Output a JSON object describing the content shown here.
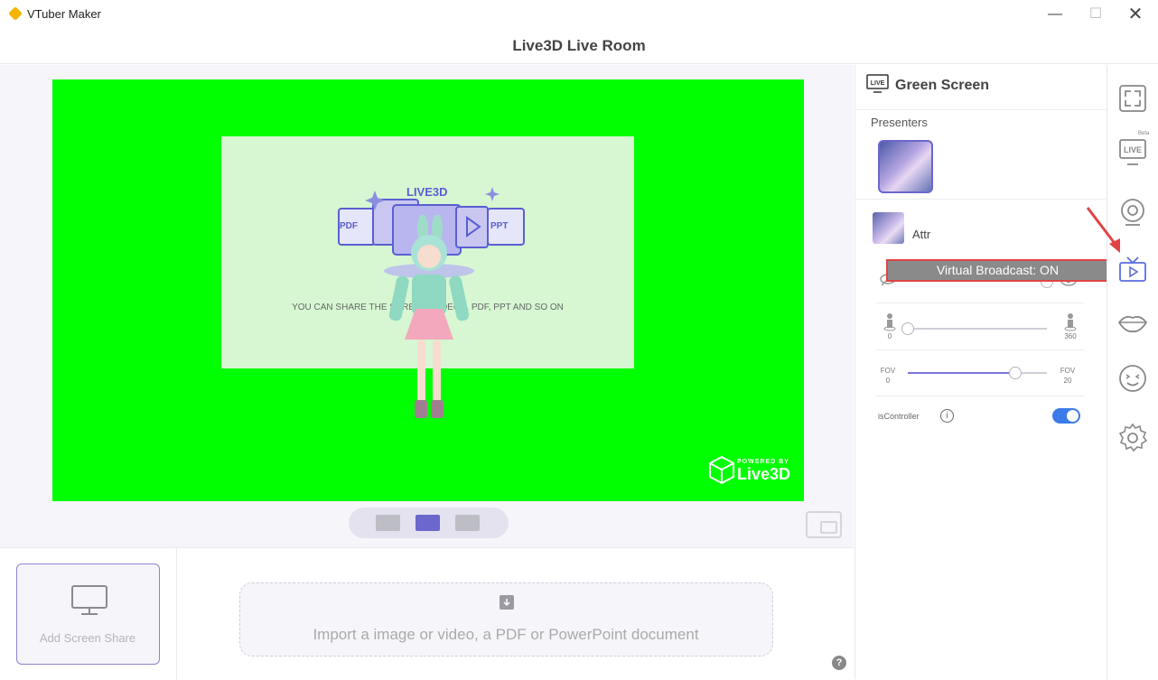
{
  "window": {
    "app_title": "VTuber Maker",
    "min_glyph": "—",
    "max_glyph": "☐",
    "close_glyph": "✕"
  },
  "header": {
    "title": "Live3D Live Room"
  },
  "stage": {
    "background_color": "#00ff00",
    "share_card_text": "YOU CAN SHARE THE SCREEN, VIDEOS, PDF, PPT AND SO ON",
    "logo_text": "LIVE3D",
    "pdf_label": "PDF",
    "ppt_label": "PPT",
    "watermark_small": "POWERED BY",
    "watermark_big": "Live3D"
  },
  "bottom": {
    "add_screen_share_label": "Add  Screen Share",
    "import_label": "Import a image or video,  a PDF or PowerPoint document",
    "help_glyph": "?"
  },
  "panel": {
    "title": "Green Screen",
    "live_icon_text": "LIVE",
    "presenters_label": "Presenters",
    "attr_label": "Attr",
    "rotation_slider": {
      "min_label": "0",
      "max_label": "360",
      "value": 0
    },
    "fov_slider": {
      "left_label": "FOV",
      "left_value": "0",
      "right_label": "FOV",
      "right_value": "20",
      "value_fraction": 0.77
    },
    "is_controller_label": "isController",
    "info_glyph": "i",
    "is_controller_on": true
  },
  "tooltip": {
    "text": "Virtual Broadcast: ON"
  },
  "rail": {
    "beta_label": "Beta",
    "live_text": "LIVE",
    "items": [
      "fullscreen-icon",
      "live-beta-icon",
      "webcam-icon",
      "virtual-broadcast-icon",
      "lips-icon",
      "face-icon",
      "settings-icon"
    ]
  },
  "colors": {
    "accent": "#6b67cc",
    "toggle_on": "#3d7be8",
    "annotation_red": "#e04444"
  }
}
